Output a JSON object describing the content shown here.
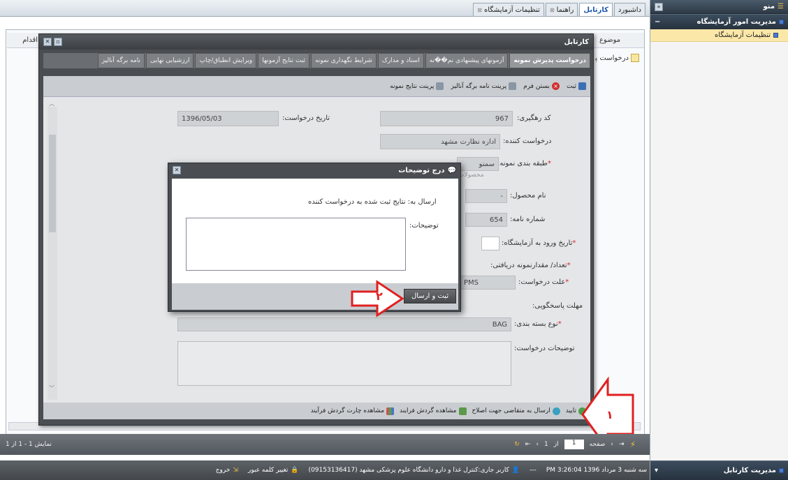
{
  "sidebar": {
    "menu_title": "منو",
    "section1": "مدیریت امور آزمایشگاه",
    "item1": "تنظیمات آزمایشگاه",
    "section2": "مدیریت کارتابل"
  },
  "top_tabs": [
    {
      "label": "داشبورد"
    },
    {
      "label": "کارتابل"
    },
    {
      "label": "راهنما"
    },
    {
      "label": "تنظیمات آزمایشگاه"
    }
  ],
  "background": {
    "col_subject": "موضوع",
    "col_action": "اقدام",
    "row_text": "درخواست پذیر"
  },
  "modal": {
    "title": "کارتابل",
    "tabs": [
      "درخواست پذیرش نمونه",
      "آزمونهای پیشنهادی نم��نه",
      "اسناد و مدارک",
      "شرایط نگهداری نمونه",
      "ثبت نتایج آزمونها",
      "ویرایش انطباق/چاپ",
      "ارزشیابی نهایی",
      "نامه برگه آنالیز"
    ],
    "toolbar": {
      "save": "ثبت",
      "close": "بستن فرم",
      "print_analysis": "پرینت نامه برگه آنالیز",
      "print_results": "پرینت نتایج نمونه"
    },
    "form": {
      "tracking_label": "کد رهگیری:",
      "tracking_value": "967",
      "request_date_label": "تاریخ درخواست:",
      "request_date_value": "1396/05/03",
      "requester_label": "درخواست کننده:",
      "requester_value": "اداره نظارت مشهد",
      "category_label": "طبقه بندی نمونه:",
      "category_value": "سمنو",
      "category_sub": "محصولات",
      "product_label": "نام محصول:",
      "product_value": "-",
      "letter_label": "شماره نامه:",
      "letter_value": "654",
      "entry_date_label": "تاریخ ورود به آزمایشگاه:",
      "count_label": "تعداد/ مقدارنمونه دریافتی:",
      "reason_label": "علت درخواست:",
      "reason_value": "PMS",
      "deadline_label": "مهلت پاسخگویی:",
      "package_label": "نوع بسته بندی:",
      "package_value": "BAG",
      "desc_label": "توضیحات درخواست:"
    },
    "footer": {
      "approve": "تایید",
      "send_back": "ارسال به متقاضی جهت اصلاح",
      "view_flow": "مشاهده گردش فرایند",
      "view_chart": "مشاهده چارت گردش فرآیند"
    }
  },
  "dialog": {
    "title": "درج توضیحات",
    "send_to": "ارسال به: نتایج ثبت شده به درخواست کننده",
    "desc_label": "توضیحات:",
    "submit": "ثبت و ارسال"
  },
  "annotations": {
    "one": "۱",
    "two": "۲"
  },
  "pager": {
    "page_label": "صفحه",
    "page_value": "1",
    "of_label": "از",
    "of_value": "1",
    "display": "نمایش 1 - 1 از 1"
  },
  "status": {
    "datetime": "سه شنبه 3 مرداد 1396 PM 3:26:04",
    "sep": "---",
    "user": "کاربر جاری:کنترل غذا و دارو دانشگاه علوم پزشکی مشهد (09153136417)",
    "change_pw": "تغییر کلمه عبور",
    "logout": "خروج"
  },
  "colors": {
    "accent_red": "#e02020",
    "selected": "#fbe7a8"
  }
}
